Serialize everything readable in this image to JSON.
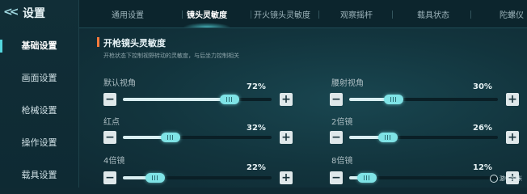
{
  "header": {
    "title": "设置",
    "back_icon": "double-chevron-left-icon"
  },
  "sidebar": {
    "items": [
      {
        "label": "基础设置",
        "active": true
      },
      {
        "label": "画面设置",
        "active": false
      },
      {
        "label": "枪械设置",
        "active": false
      },
      {
        "label": "操作设置",
        "active": false
      },
      {
        "label": "载具设置",
        "active": false
      }
    ]
  },
  "tabs": [
    {
      "label": "通用设置",
      "active": false
    },
    {
      "label": "镜头灵敏度",
      "active": true
    },
    {
      "label": "开火镜头灵敏度",
      "active": false
    },
    {
      "label": "观察摇杆",
      "active": false
    },
    {
      "label": "载具状态",
      "active": false
    },
    {
      "label": "陀螺仪",
      "active": false
    }
  ],
  "section": {
    "title": "开枪镜头灵敏度",
    "subtitle": "开枪状态下控制视野转动的灵敏度，与后坐力控制相关"
  },
  "sliders": [
    {
      "label": "默认视角",
      "value_text": "72%",
      "value": 0.72
    },
    {
      "label": "腰射视角",
      "value_text": "30%",
      "value": 0.3
    },
    {
      "label": "红点",
      "value_text": "32%",
      "value": 0.32
    },
    {
      "label": "2倍镜",
      "value_text": "26%",
      "value": 0.26
    },
    {
      "label": "4倍镜",
      "value_text": "22%",
      "value": 0.22
    },
    {
      "label": "8倍镜",
      "value_text": "12%",
      "value": 0.12
    }
  ],
  "controls": {
    "minus": "−",
    "plus": "+"
  },
  "watermark": {
    "text": "游中超米"
  },
  "colors": {
    "accent": "#54d7de",
    "section_marker": "#ff7a3c",
    "background": "#0f2a33"
  }
}
